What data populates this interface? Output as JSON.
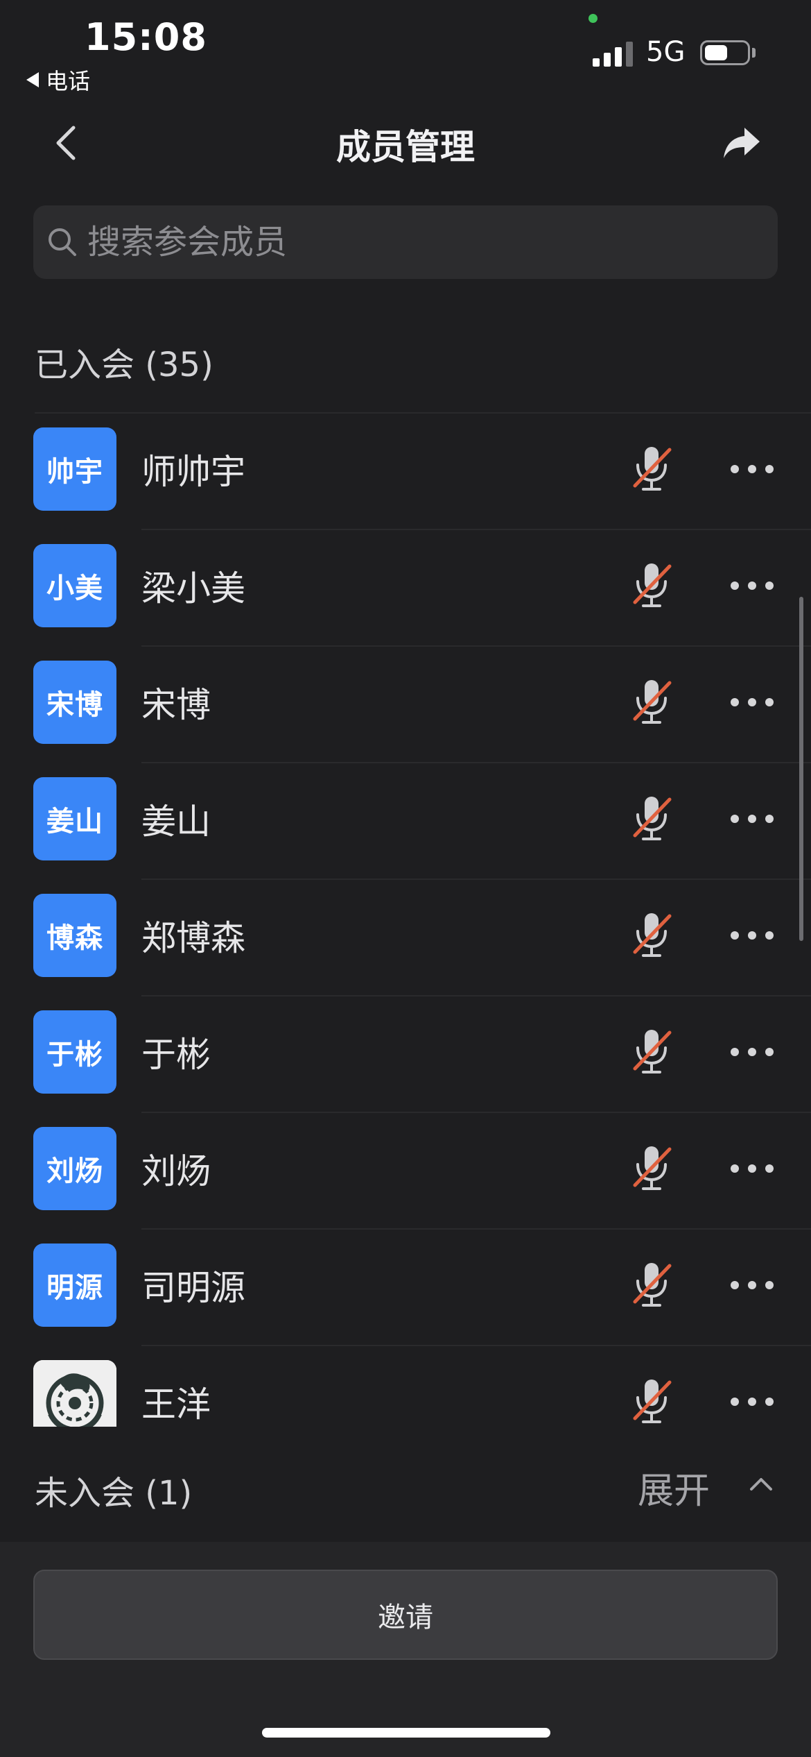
{
  "status_bar": {
    "time": "15:08",
    "back_app": "电话",
    "network": "5G",
    "signal_bars_filled": 3,
    "battery_level": 0.55
  },
  "nav": {
    "title": "成员管理"
  },
  "search": {
    "placeholder": "搜索参会成员",
    "value": ""
  },
  "joined": {
    "header": "已入会 (35)",
    "members": [
      {
        "avatar_text": "帅宇",
        "name": "师帅宇",
        "muted": true
      },
      {
        "avatar_text": "小美",
        "name": "梁小美",
        "muted": true
      },
      {
        "avatar_text": "宋博",
        "name": "宋博",
        "muted": true
      },
      {
        "avatar_text": "姜山",
        "name": "姜山",
        "muted": true
      },
      {
        "avatar_text": "博森",
        "name": "郑博森",
        "muted": true
      },
      {
        "avatar_text": "于彬",
        "name": "于彬",
        "muted": true
      },
      {
        "avatar_text": "刘炀",
        "name": "刘炀",
        "muted": true
      },
      {
        "avatar_text": "明源",
        "name": "司明源",
        "muted": true
      },
      {
        "avatar_text": "",
        "avatar_icon": "dragon-emblem-image",
        "name": "王洋",
        "muted": true
      }
    ]
  },
  "not_joined": {
    "header": "未入会 (1)",
    "expand_label": "展开"
  },
  "invite_button": "邀请",
  "colors": {
    "background": "#1e1e20",
    "avatar_blue": "#3a86f7",
    "mute_slash": "#e0613f",
    "signal_dot": "#3fc35a"
  },
  "icons": {
    "back": "chevron-left-icon",
    "share": "share-arrow-icon",
    "search": "search-icon",
    "mic": "mic-muted-icon",
    "more": "more-dots-icon",
    "collapse": "chevron-up-icon"
  }
}
